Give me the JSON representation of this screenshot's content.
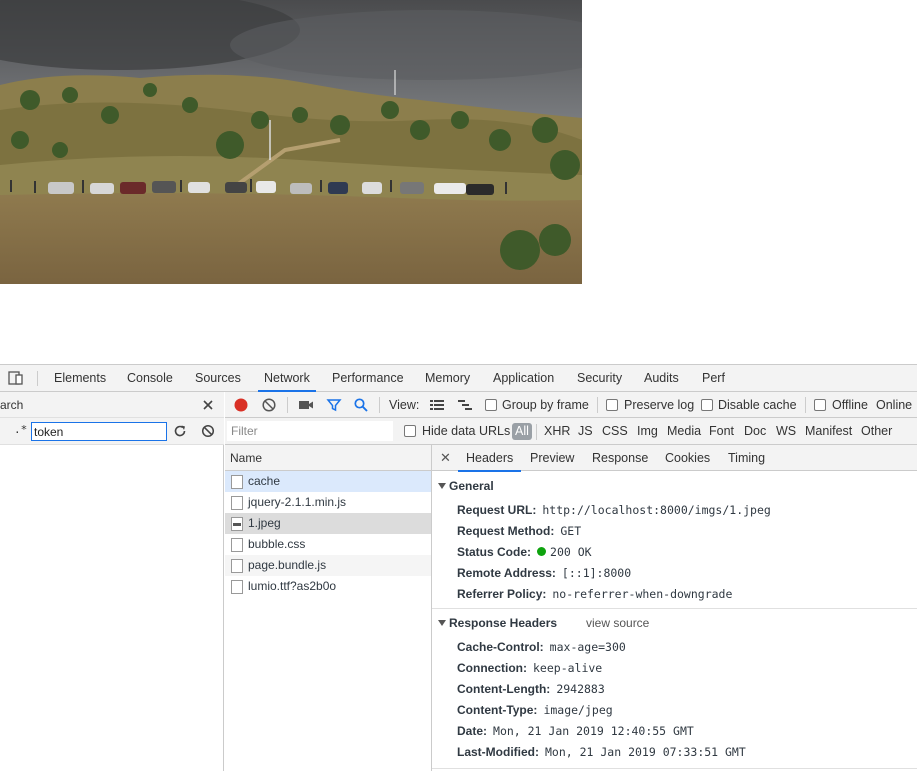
{
  "devtools": {
    "tabs": [
      "Elements",
      "Console",
      "Sources",
      "Network",
      "Performance",
      "Memory",
      "Application",
      "Security",
      "Audits",
      "Perf"
    ],
    "active_tab": "Network"
  },
  "search": {
    "title": "arch",
    "regex_label": ".*",
    "query": "token"
  },
  "network_toolbar": {
    "view_label": "View:",
    "group_by_frame": "Group by frame",
    "preserve_log": "Preserve log",
    "disable_cache": "Disable cache",
    "offline": "Offline",
    "online": "Online"
  },
  "filter_bar": {
    "placeholder": "Filter",
    "hide_data_urls": "Hide data URLs",
    "types": [
      "All",
      "XHR",
      "JS",
      "CSS",
      "Img",
      "Media",
      "Font",
      "Doc",
      "WS",
      "Manifest",
      "Other"
    ]
  },
  "requests": {
    "column_name": "Name",
    "items": [
      "cache",
      "jquery-2.1.1.min.js",
      "1.jpeg",
      "bubble.css",
      "page.bundle.js",
      "lumio.ttf?as2b0o"
    ]
  },
  "detail": {
    "tabs": [
      "Headers",
      "Preview",
      "Response",
      "Cookies",
      "Timing"
    ],
    "active_tab": "Headers",
    "general_title": "General",
    "general": [
      {
        "k": "Request URL:",
        "v": "http://localhost:8000/imgs/1.jpeg"
      },
      {
        "k": "Request Method:",
        "v": "GET"
      },
      {
        "k": "Status Code:",
        "v": "200 OK"
      },
      {
        "k": "Remote Address:",
        "v": "[::1]:8000"
      },
      {
        "k": "Referrer Policy:",
        "v": "no-referrer-when-downgrade"
      }
    ],
    "response_title": "Response Headers",
    "view_source": "view source",
    "response": [
      {
        "k": "Cache-Control:",
        "v": "max-age=300"
      },
      {
        "k": "Connection:",
        "v": "keep-alive"
      },
      {
        "k": "Content-Length:",
        "v": "2942883"
      },
      {
        "k": "Content-Type:",
        "v": "image/jpeg"
      },
      {
        "k": "Date:",
        "v": "Mon, 21 Jan 2019 12:40:55 GMT"
      },
      {
        "k": "Last-Modified:",
        "v": "Mon, 21 Jan 2019 07:33:51 GMT"
      }
    ]
  },
  "colors": {
    "accent": "#1a73e8",
    "record": "#d93025",
    "status_ok": "#0ea30e",
    "selected_row": "#dcdcdc",
    "highlighted_row": "#dbe9fc"
  }
}
